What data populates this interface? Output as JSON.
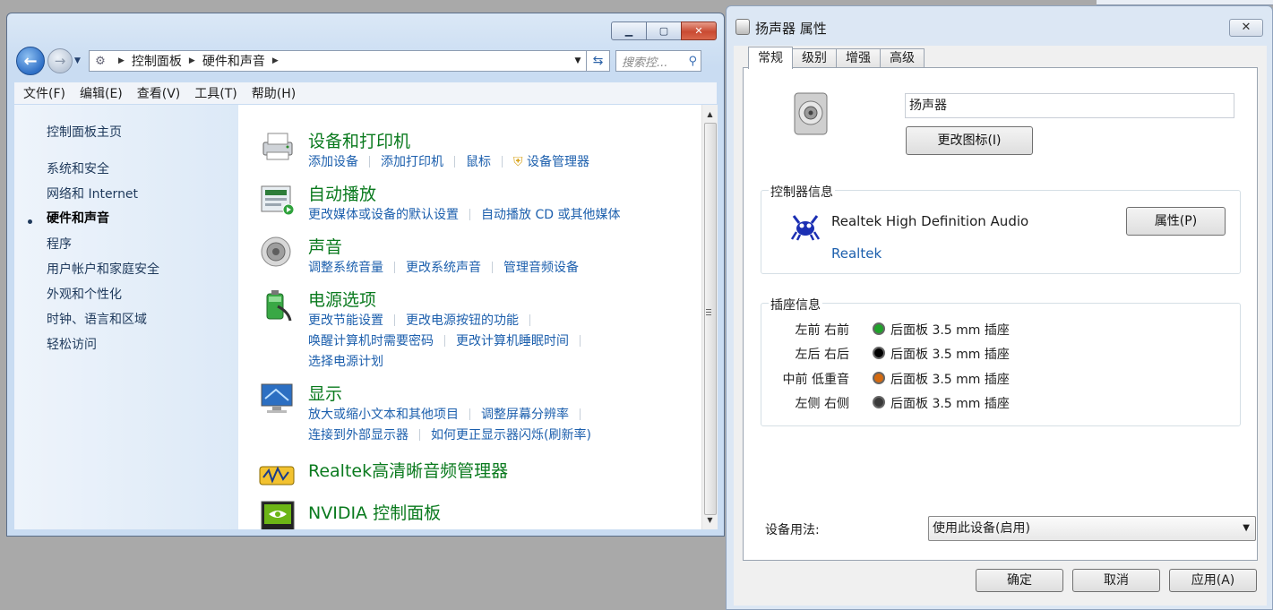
{
  "control_panel": {
    "address": {
      "crumbs": [
        "控制面板",
        "硬件和声音"
      ]
    },
    "search_placeholder": "搜索控...",
    "menu": [
      "文件(F)",
      "编辑(E)",
      "查看(V)",
      "工具(T)",
      "帮助(H)"
    ],
    "sidebar": {
      "home": "控制面板主页",
      "items": [
        "系统和安全",
        "网络和 Internet",
        "硬件和声音",
        "程序",
        "用户帐户和家庭安全",
        "外观和个性化",
        "时钟、语言和区域",
        "轻松访问"
      ],
      "current_index": 2
    },
    "categories": {
      "devices": {
        "title": "设备和打印机",
        "links": [
          "添加设备",
          "添加打印机",
          "鼠标",
          "设备管理器"
        ]
      },
      "autoplay": {
        "title": "自动播放",
        "links": [
          "更改媒体或设备的默认设置",
          "自动播放 CD 或其他媒体"
        ]
      },
      "sound": {
        "title": "声音",
        "links": [
          "调整系统音量",
          "更改系统声音",
          "管理音频设备"
        ]
      },
      "power": {
        "title": "电源选项",
        "links": [
          "更改节能设置",
          "更改电源按钮的功能",
          "唤醒计算机时需要密码",
          "更改计算机睡眠时间",
          "选择电源计划"
        ]
      },
      "display": {
        "title": "显示",
        "links": [
          "放大或缩小文本和其他项目",
          "调整屏幕分辨率",
          "连接到外部显示器",
          "如何更正显示器闪烁(刷新率)"
        ]
      },
      "realtek": {
        "title": "Realtek高清晰音频管理器"
      },
      "nvidia": {
        "title": "NVIDIA 控制面板"
      }
    }
  },
  "dialog": {
    "title": "扬声器 属性",
    "tabs": [
      "常规",
      "级别",
      "增强",
      "高级"
    ],
    "active_tab": 0,
    "device_name": "扬声器",
    "change_icon_label": "更改图标(I)",
    "controller": {
      "group_label": "控制器信息",
      "name": "Realtek High Definition Audio",
      "vendor": "Realtek",
      "properties_label": "属性(P)"
    },
    "jacks": {
      "group_label": "插座信息",
      "rows": [
        {
          "name": "左前 右前",
          "desc": "后面板 3.5 mm 插座",
          "color": "#1fa22a"
        },
        {
          "name": "左后 右后",
          "desc": "后面板 3.5 mm 插座",
          "color": "#000000"
        },
        {
          "name": "中前 低重音",
          "desc": "后面板 3.5 mm 插座",
          "color": "#d46a10"
        },
        {
          "name": "左侧 右侧",
          "desc": "后面板 3.5 mm 插座",
          "color": "#3a3a3a"
        }
      ]
    },
    "usage": {
      "label": "设备用法:",
      "value": "使用此设备(启用)"
    },
    "buttons": {
      "ok": "确定",
      "cancel": "取消",
      "apply": "应用(A)"
    }
  }
}
